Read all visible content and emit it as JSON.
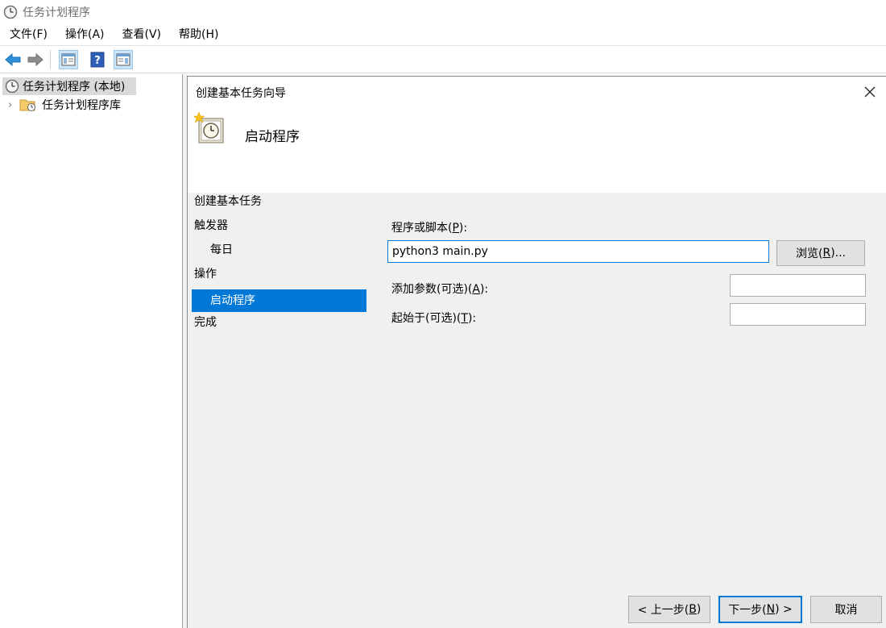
{
  "window": {
    "title": "任务计划程序"
  },
  "menu": [
    {
      "label": "文件(F)"
    },
    {
      "label": "操作(A)"
    },
    {
      "label": "查看(V)"
    },
    {
      "label": "帮助(H)"
    }
  ],
  "toolbar": {
    "icons": [
      "back-arrow-icon",
      "forward-arrow-icon",
      "show-hide-tree-icon",
      "help-icon",
      "show-hide-action-pane-icon"
    ]
  },
  "tree": {
    "root_label": "任务计划程序 (本地)",
    "child_chevron": "›",
    "child_label": "任务计划程序库"
  },
  "wizard": {
    "title": "创建基本任务向导",
    "close_glyph": "✕",
    "heading": "启动程序",
    "steps": {
      "create": "创建基本任务",
      "trigger": "触发器",
      "daily": "每日",
      "action": "操作",
      "start_program": "启动程序",
      "finish": "完成"
    },
    "form": {
      "program_label_pre": "程序或脚本(",
      "program_label_key": "P",
      "program_label_post": "):",
      "program_value": "python3 main.py",
      "browse_pre": "浏览(",
      "browse_key": "R",
      "browse_post": ")...",
      "args_label_pre": "添加参数(可选)(",
      "args_label_key": "A",
      "args_label_post": "):",
      "args_value": "",
      "start_label_pre": "起始于(可选)(",
      "start_label_key": "T",
      "start_label_post": "):",
      "start_value": ""
    },
    "buttons": {
      "back_pre": "< 上一步(",
      "back_key": "B",
      "back_post": ")",
      "next_pre": "下一步(",
      "next_key": "N",
      "next_post": ") >",
      "cancel": "取消"
    }
  },
  "colors": {
    "selection": "#0078d7",
    "dialog_bg": "#f0f0f0",
    "tree_selected": "#d9d9d9"
  }
}
